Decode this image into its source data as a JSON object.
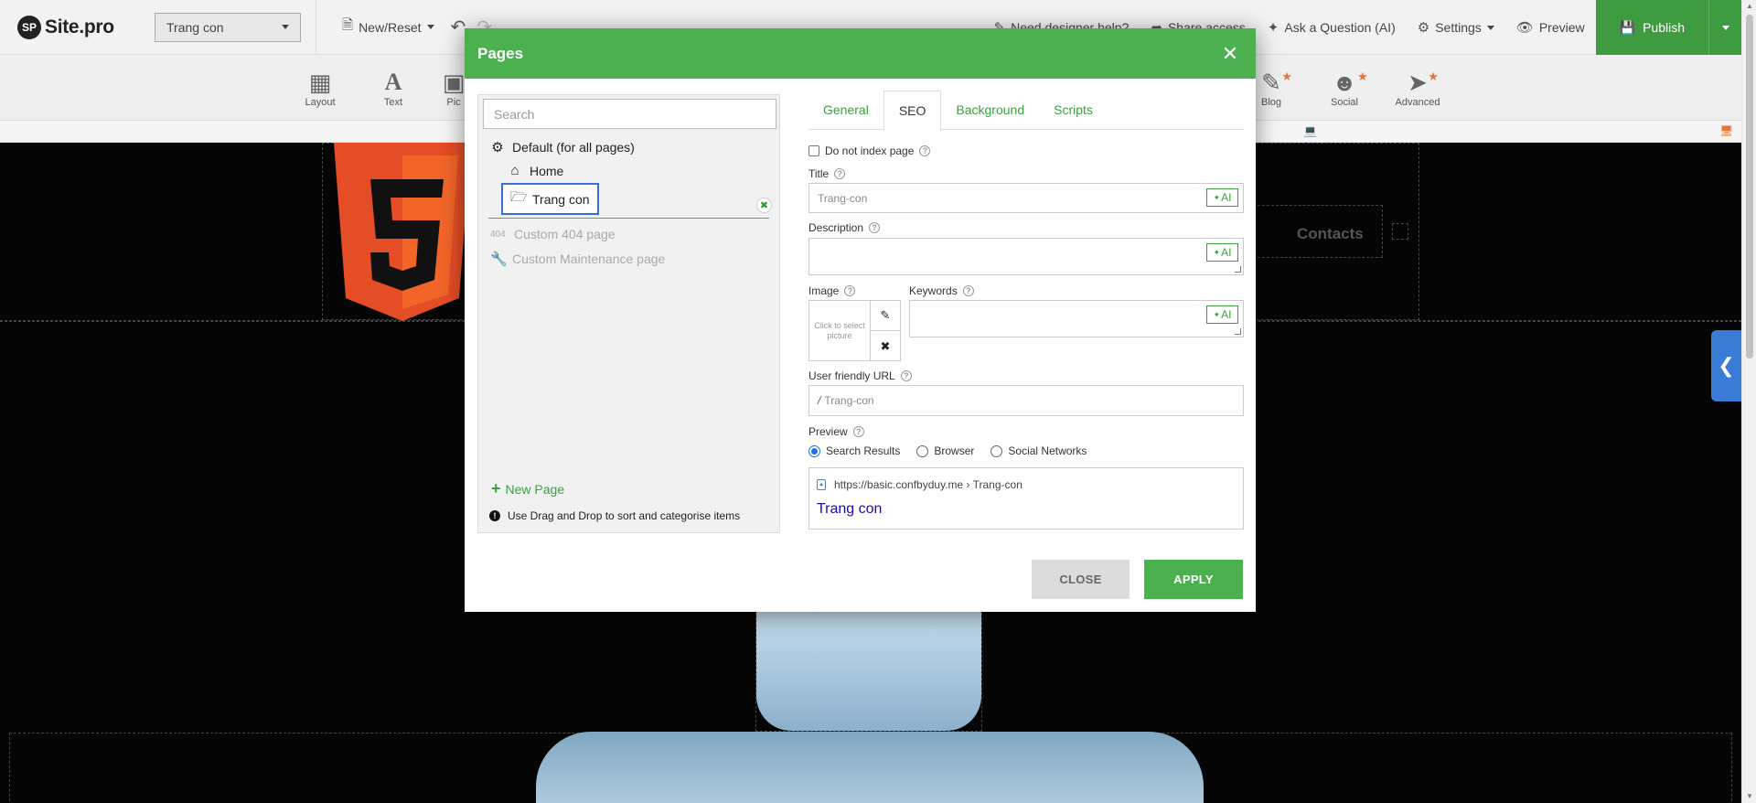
{
  "app": {
    "logo_badge": "SP",
    "logo_text": "Site.pro"
  },
  "topbar": {
    "page_select": "Trang con",
    "new_reset": "New/Reset",
    "designer_help": "Need designer help?",
    "share_access": "Share access",
    "ask_question": "Ask a Question (AI)",
    "settings": "Settings",
    "preview": "Preview",
    "publish": "Publish"
  },
  "widgets": [
    {
      "label": "Layout",
      "icon": "layout-icon",
      "star": false
    },
    {
      "label": "Text",
      "icon": "text-icon",
      "star": false
    },
    {
      "label": "Pic",
      "icon": "picture-icon",
      "star": false
    },
    {
      "label": "Blog",
      "icon": "blog-icon",
      "star": true
    },
    {
      "label": "Social",
      "icon": "social-icon",
      "star": true
    },
    {
      "label": "Advanced",
      "icon": "rocket-icon",
      "star": true
    }
  ],
  "canvas": {
    "nav_contacts": "Contacts",
    "accent_blue": "#3a7bd5"
  },
  "modal": {
    "title": "Pages",
    "header_color": "#4caf50",
    "search_placeholder": "Search",
    "tree": {
      "default": "Default (for all pages)",
      "home": "Home",
      "selected": "Trang con",
      "custom_404_tag": "404",
      "custom_404": "Custom 404 page",
      "maintenance": "Custom Maintenance page"
    },
    "new_page": "New Page",
    "hint": "Use Drag and Drop to sort and categorise items",
    "tabs": [
      {
        "label": "General",
        "active": false
      },
      {
        "label": "SEO",
        "active": true
      },
      {
        "label": "Background",
        "active": false
      },
      {
        "label": "Scripts",
        "active": false
      }
    ],
    "seo": {
      "no_index_label": "Do not index page",
      "title_label": "Title",
      "title_value": "Trang-con",
      "description_label": "Description",
      "description_value": "",
      "image_label": "Image",
      "image_placeholder": "Click to select picture",
      "keywords_label": "Keywords",
      "keywords_value": "",
      "ai_label": "AI",
      "url_label": "User friendly URL",
      "url_prefix": "/",
      "url_value": "Trang-con",
      "preview_label": "Preview",
      "preview_options": [
        "Search Results",
        "Browser",
        "Social Networks"
      ],
      "preview_selected": "Search Results",
      "preview_url": "https://basic.confbyduy.me › Trang-con",
      "preview_title": "Trang con"
    },
    "close_label": "CLOSE",
    "apply_label": "APPLY"
  }
}
